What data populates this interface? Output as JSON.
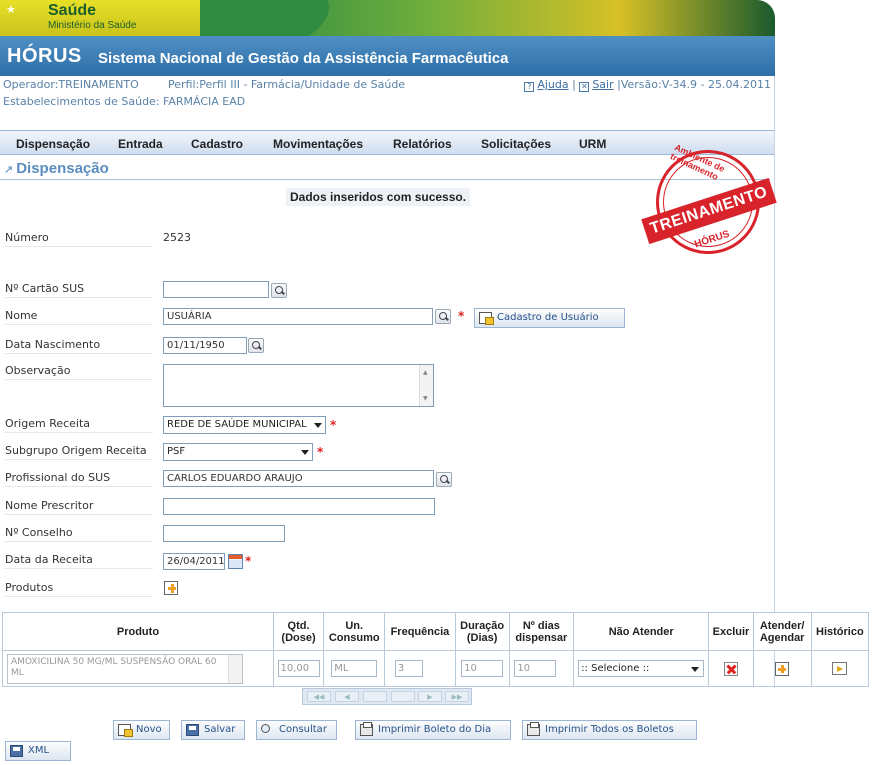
{
  "brand": {
    "saude": "Saúde",
    "ministerio": "Ministério da Saúde"
  },
  "header": {
    "app": "HÓRUS",
    "subtitle": "Sistema Nacional de Gestão da Assistência Farmacêutica"
  },
  "session": {
    "operador": "Operador:TREINAMENTO",
    "perfil": "Perfil:Perfil III - Farmácia/Unidade de Saúde",
    "estabelecimento": "Estabelecimentos de Saúde: FARMÁCIA EAD",
    "ajuda": "Ajuda",
    "sair": "Sair",
    "versao": "|Versão:V-34.9 - 25.04.2011"
  },
  "menu": [
    "Dispensação",
    "Entrada",
    "Cadastro",
    "Movimentações",
    "Relatórios",
    "Solicitações",
    "URM"
  ],
  "page_title": "Dispensação",
  "success_message": "Dados inseridos com sucesso.",
  "stamp": {
    "top": "Ambiente de treinamento",
    "band": "TREINAMENTO",
    "bottom": "HÓRUS"
  },
  "form": {
    "numero_label": "Número",
    "numero": "2523",
    "cartao_label": "Nº Cartão SUS",
    "cartao": "",
    "nome_label": "Nome",
    "nome": "USUÁRIA",
    "cadastro_usuario": "Cadastro de Usuário",
    "nascimento_label": "Data Nascimento",
    "nascimento": "01/11/1950",
    "observacao_label": "Observação",
    "origem_label": "Origem Receita",
    "origem": "REDE DE SAÚDE MUNICIPAL",
    "subgrupo_label": "Subgrupo Origem Receita",
    "subgrupo": "PSF",
    "profissional_label": "Profissional do SUS",
    "profissional": "CARLOS EDUARDO ARAUJO",
    "prescritor_label": "Nome Prescritor",
    "conselho_label": "Nº Conselho",
    "data_receita_label": "Data da Receita",
    "data_receita": "26/04/2011",
    "produtos_label": "Produtos",
    "required_mark": "*"
  },
  "table": {
    "headers": [
      "Produto",
      "Qtd. (Dose)",
      "Un. Consumo",
      "Frequência",
      "Duração (Dias)",
      "Nº dias dispensar",
      "Não Atender",
      "Excluir",
      "Atender/ Agendar",
      "Histórico"
    ],
    "row": {
      "produto": "AMOXICILINA 50 MG/ML SUSPENSÃO ORAL 60 ML",
      "qtd": "10,00",
      "un": "ML",
      "freq": "3",
      "duracao": "10",
      "dias": "10",
      "nao_atender": ":: Selecione ::"
    }
  },
  "buttons": {
    "novo": "Novo",
    "salvar": "Salvar",
    "consultar": "Consultar",
    "imprimir_dia": "Imprimir Boleto do Dia",
    "imprimir_todos": "Imprimir Todos os Boletos",
    "xml": "XML"
  },
  "colors": {
    "accent": "#2f6fa8",
    "stamp": "#d9232b",
    "required": "#dd2222"
  }
}
